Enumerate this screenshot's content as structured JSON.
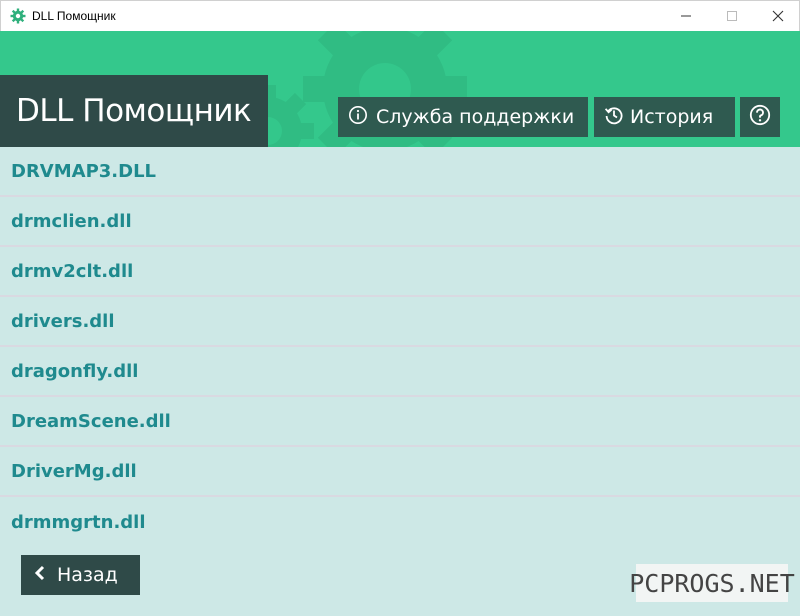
{
  "window": {
    "title": "DLL Помощник",
    "icon": "gear-icon",
    "controls": [
      "minimize-icon",
      "maximize-icon",
      "close-icon"
    ]
  },
  "header": {
    "app_title": "DLL Помощник",
    "support_button": {
      "label": "Служба поддержки",
      "icon": "info-icon"
    },
    "history_button": {
      "label": "История",
      "icon": "history-icon"
    },
    "help_button": {
      "icon": "question-icon"
    }
  },
  "dll_list": {
    "items": [
      "DRVMAP3.DLL",
      "drmclien.dll",
      "drmv2clt.dll",
      "drivers.dll",
      "dragonfly.dll",
      "DreamScene.dll",
      "DriverMg.dll",
      "drmmgrtn.dll"
    ]
  },
  "footer": {
    "back_button": {
      "label": "Назад",
      "icon": "chevron-left-icon"
    }
  },
  "watermark": "PCPROGS.NET",
  "colors": {
    "header_green": "#34c88c",
    "dark_panel": "#2f4a48",
    "button_dark": "#2f5a50",
    "list_bg": "#cde8e6",
    "item_text": "#1f8a8e"
  }
}
